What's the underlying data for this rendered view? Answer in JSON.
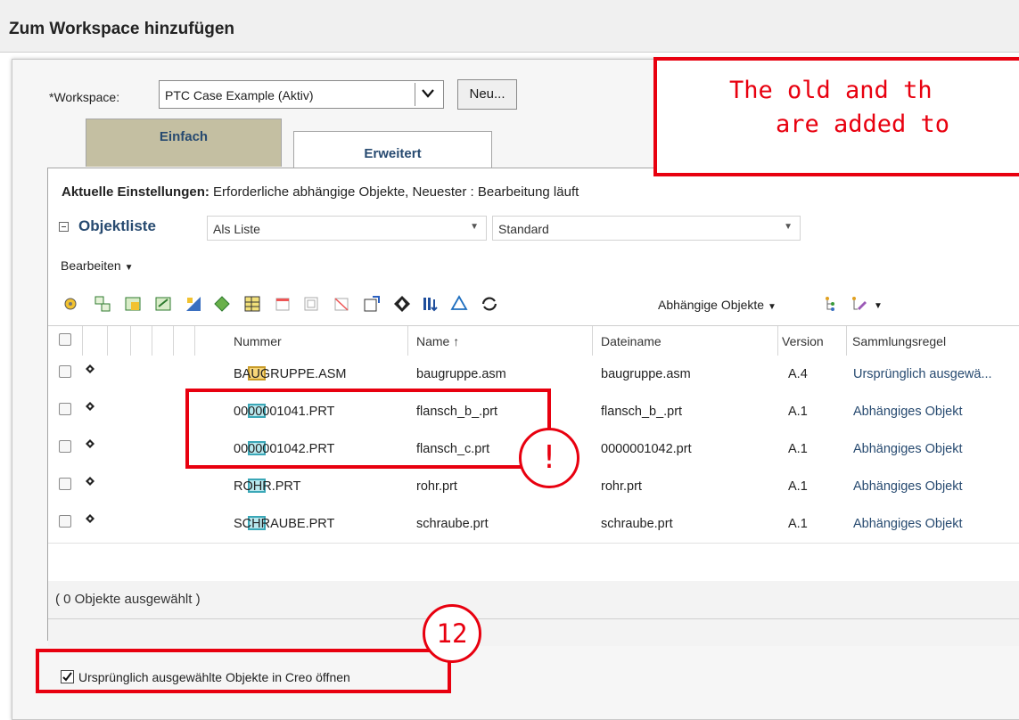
{
  "window": {
    "title": "Zum Workspace hinzufügen"
  },
  "workspace": {
    "label": "*Workspace:",
    "selected": "PTC Case Example (Aktiv)",
    "new_button": "Neu..."
  },
  "tabs": [
    {
      "label": "Einfach"
    },
    {
      "label": "Erweitert"
    }
  ],
  "settings": {
    "label": "Aktuelle Einstellungen:",
    "value": "Erforderliche abhängige Objekte, Neuester : Bearbeitung läuft"
  },
  "object_list": {
    "title": "Objektliste",
    "view": "Als Liste",
    "filter": "Standard"
  },
  "edit_menu": {
    "label": "Bearbeiten"
  },
  "toolbar": {
    "dependents_label": "Abhängige Objekte"
  },
  "table": {
    "headers": {
      "number": "Nummer",
      "name": "Name",
      "sort_indicator": "↑",
      "filename": "Dateiname",
      "version": "Version",
      "rule": "Sammlungsregel"
    },
    "rows": [
      {
        "type": "asm",
        "number": "BAUGRUPPE.ASM",
        "name": "baugruppe.asm",
        "filename": "baugruppe.asm",
        "version": "A.4",
        "rule": "Ursprünglich ausgewä..."
      },
      {
        "type": "prt",
        "number": "0000001041.PRT",
        "name": "flansch_b_.prt",
        "filename": "flansch_b_.prt",
        "version": "A.1",
        "rule": "Abhängiges Objekt"
      },
      {
        "type": "prt",
        "number": "0000001042.PRT",
        "name": "flansch_c.prt",
        "filename": "0000001042.prt",
        "version": "A.1",
        "rule": "Abhängiges Objekt"
      },
      {
        "type": "prt",
        "number": "ROHR.PRT",
        "name": "rohr.prt",
        "filename": "rohr.prt",
        "version": "A.1",
        "rule": "Abhängiges Objekt"
      },
      {
        "type": "prt",
        "number": "SCHRAUBE.PRT",
        "name": "schraube.prt",
        "filename": "schraube.prt",
        "version": "A.1",
        "rule": "Abhängiges Objekt"
      }
    ]
  },
  "status": {
    "selected": "( 0 Objekte ausgewählt )"
  },
  "open_option": {
    "label": "Ursprünglich ausgewählte Objekte in Creo öffnen",
    "checked": true
  },
  "annotations": {
    "callout_line1": "The old and th",
    "callout_line2": "are added to",
    "marker_exclaim": "!",
    "marker_number": "12"
  },
  "colors": {
    "annotation_red": "#e8000f",
    "link_blue": "#274a70",
    "tab_inactive": "#c4bfa2"
  }
}
